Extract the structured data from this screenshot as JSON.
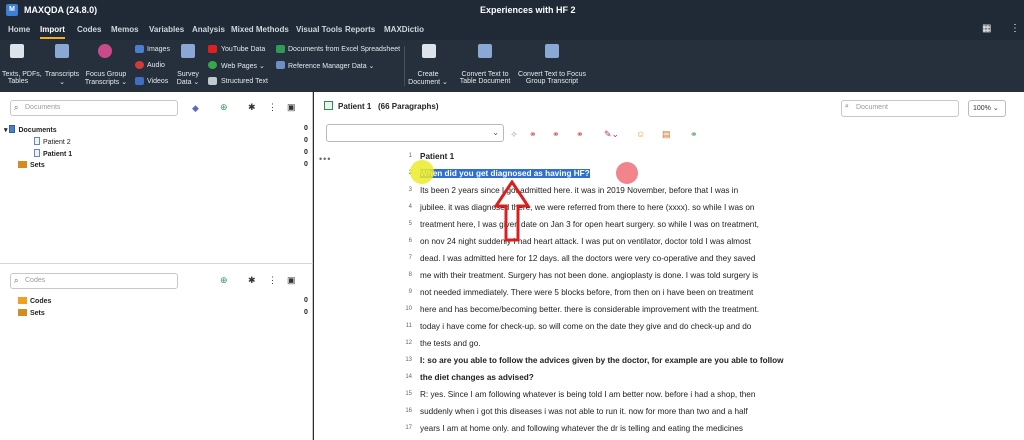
{
  "titlebar": {
    "app": "MAXQDA (24.8.0)",
    "project": "Experiences with HF 2"
  },
  "menu": [
    "Home",
    "Import",
    "Codes",
    "Memos",
    "Variables",
    "Analysis",
    "Mixed Methods",
    "Visual Tools",
    "Reports",
    "MAXDictio"
  ],
  "menu_active": "Import",
  "ribbon": {
    "texts_pdfs": "Texts, PDFs,",
    "tables": "Tables",
    "transcripts": "Transcripts",
    "focus_group_1": "Focus Group",
    "focus_group_2": "Transcripts",
    "images": "Images",
    "audio": "Audio",
    "videos": "Videos",
    "survey_1": "Survey",
    "survey_2": "Data",
    "youtube": "YouTube Data",
    "web_pages": "Web Pages",
    "structured_text": "Structured Text",
    "excel": "Documents from Excel Spreadsheet",
    "reference": "Reference Manager Data",
    "create_1": "Create",
    "create_2": "Document",
    "convert_table_1": "Convert Text to",
    "convert_table_2": "Table Document",
    "convert_focus_1": "Convert Text to Focus",
    "convert_focus_2": "Group Transcript"
  },
  "documents_panel": {
    "search_placeholder": "Documents",
    "root": "Documents",
    "items": [
      "Patient 2",
      "Patient 1"
    ],
    "sets": "Sets",
    "counts": [
      "0",
      "0",
      "0",
      "0"
    ]
  },
  "codes_panel": {
    "search_placeholder": "Codes",
    "codes": "Codes",
    "sets": "Sets",
    "counts": [
      "0",
      "0"
    ]
  },
  "browser": {
    "title": "Patient 1",
    "paragraphs": "(66 Paragraphs)",
    "search_placeholder": "Document",
    "zoom": "100%",
    "lines": [
      {
        "n": "1",
        "t": "Patient 1",
        "bold": true
      },
      {
        "n": "2",
        "t": "When did you get diagnosed as having HF?",
        "bold": true,
        "hl": true
      },
      {
        "n": "3",
        "t": "Its been 2 years since I got admitted here. it was in 2019 November, before that I was in"
      },
      {
        "n": "4",
        "t": "jubilee. it was diagnosed there, we were referred from there to here (xxxx). so while I was on"
      },
      {
        "n": "5",
        "t": "treatment here, I was given date on Jan 3 for open heart surgery. so while I was on treatment,"
      },
      {
        "n": "6",
        "t": "on nov 24 night suddenly I had heart attack. I was put on ventilator, doctor told I was almost"
      },
      {
        "n": "7",
        "t": "dead. I was admitted here for 12 days. all the doctors were very co-operative and they saved"
      },
      {
        "n": "8",
        "t": "me with their treatment. Surgery has not been done. angioplasty is done. I was told surgery is"
      },
      {
        "n": "9",
        "t": "not needed immediately. There were 5 blocks before, from then on i have been on treatment"
      },
      {
        "n": "10",
        "t": "here and has become/becoming better. there is considerable improvement with the treatment."
      },
      {
        "n": "11",
        "t": "today i have come for check-up. so will come on the date they give and do check-up and do"
      },
      {
        "n": "12",
        "t": "the tests and go."
      },
      {
        "n": "13",
        "t": "I: so are you able to follow the advices given by the doctor, for example are you able to follow",
        "bold": true
      },
      {
        "n": "14",
        "t": "the diet changes as advised?",
        "bold": true
      },
      {
        "n": "15",
        "t": "R: yes. Since I am following whatever is being told I am better now. before i had a shop, then"
      },
      {
        "n": "16",
        "t": "suddenly when i got this diseases i was not able to run it. now for more than two and a half"
      },
      {
        "n": "17",
        "t": "years I am at home only. and following whatever the dr is telling and eating the medicines"
      }
    ]
  },
  "colors": {
    "highlight": "#2f6fcf",
    "marker_yellow": "#ebeb28",
    "marker_red": "#f06e78",
    "arrow": "#d82020"
  }
}
